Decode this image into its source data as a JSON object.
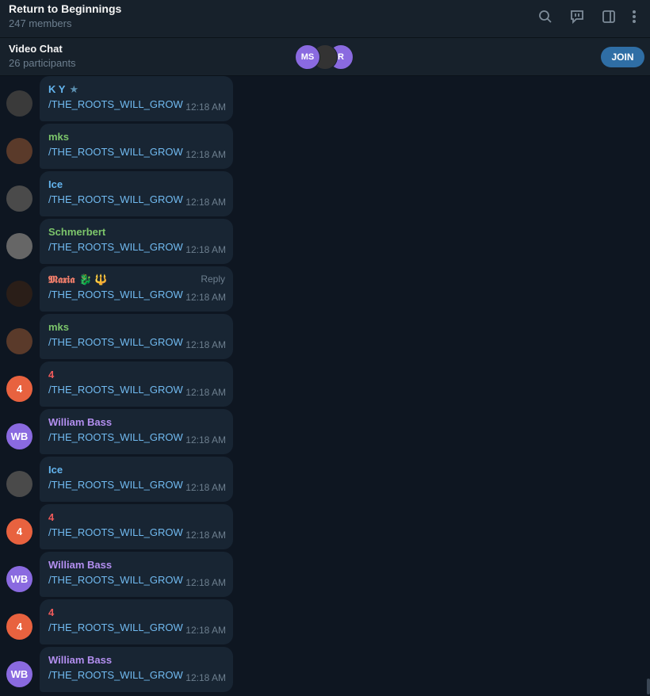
{
  "header": {
    "title": "Return to Beginnings",
    "subtitle": "247 members",
    "icons": [
      "search-icon",
      "video-chat-icon",
      "sidebar-icon",
      "more-icon"
    ]
  },
  "video_chat": {
    "title": "Video Chat",
    "subtitle": "26 participants",
    "avatars": [
      "MS",
      "",
      "R"
    ],
    "join_label": "JOIN"
  },
  "colors": {
    "background": "#0e1621",
    "bubble": "#182533",
    "link": "#71baf0",
    "accent": "#2f6ea5"
  },
  "messages": [
    {
      "sender": "K Y",
      "badge": "★",
      "sender_color": "#64b5ef",
      "avatar_text": "",
      "avatar_color": "#3a3a3a",
      "text": "/THE_ROOTS_WILL_GROW",
      "time": "12:18 AM"
    },
    {
      "sender": "mks",
      "sender_color": "#7cc56b",
      "avatar_text": "",
      "avatar_color": "#5a3a2a",
      "text": "/THE_ROOTS_WILL_GROW",
      "time": "12:18 AM"
    },
    {
      "sender": "Ice",
      "sender_color": "#64b5ef",
      "avatar_text": "",
      "avatar_color": "#4a4a4a",
      "text": "/THE_ROOTS_WILL_GROW",
      "time": "12:18 AM"
    },
    {
      "sender": "Schmerbert",
      "sender_color": "#7cc56b",
      "avatar_text": "",
      "avatar_color": "#666666",
      "text": "/THE_ROOTS_WILL_GROW",
      "time": "12:18 AM"
    },
    {
      "sender": "𝕸𝖆𝖝𝖎𝖆",
      "badge": "🐉 🔱",
      "sender_color": "#ee7d6a",
      "avatar_text": "",
      "avatar_color": "#2a1e18",
      "text": "/THE_ROOTS_WILL_GROW",
      "time": "12:18 AM",
      "reply": "Reply"
    },
    {
      "sender": "mks",
      "sender_color": "#7cc56b",
      "avatar_text": "",
      "avatar_color": "#5a3a2a",
      "text": "/THE_ROOTS_WILL_GROW",
      "time": "12:18 AM"
    },
    {
      "sender": "4",
      "sender_color": "#ee5a5a",
      "avatar_text": "4",
      "avatar_color": "#e8623f",
      "text": "/THE_ROOTS_WILL_GROW",
      "time": "12:18 AM"
    },
    {
      "sender": "William Bass",
      "sender_color": "#b38ff0",
      "avatar_text": "WB",
      "avatar_color": "#8a6ae0",
      "text": "/THE_ROOTS_WILL_GROW",
      "time": "12:18 AM"
    },
    {
      "sender": "Ice",
      "sender_color": "#64b5ef",
      "avatar_text": "",
      "avatar_color": "#4a4a4a",
      "text": "/THE_ROOTS_WILL_GROW",
      "time": "12:18 AM"
    },
    {
      "sender": "4",
      "sender_color": "#ee5a5a",
      "avatar_text": "4",
      "avatar_color": "#e8623f",
      "text": "/THE_ROOTS_WILL_GROW",
      "time": "12:18 AM"
    },
    {
      "sender": "William Bass",
      "sender_color": "#b38ff0",
      "avatar_text": "WB",
      "avatar_color": "#8a6ae0",
      "text": "/THE_ROOTS_WILL_GROW",
      "time": "12:18 AM"
    },
    {
      "sender": "4",
      "sender_color": "#ee5a5a",
      "avatar_text": "4",
      "avatar_color": "#e8623f",
      "text": "/THE_ROOTS_WILL_GROW",
      "time": "12:18 AM"
    },
    {
      "sender": "William Bass",
      "sender_color": "#b38ff0",
      "avatar_text": "WB",
      "avatar_color": "#8a6ae0",
      "text": "/THE_ROOTS_WILL_GROW",
      "time": "12:18 AM"
    }
  ]
}
